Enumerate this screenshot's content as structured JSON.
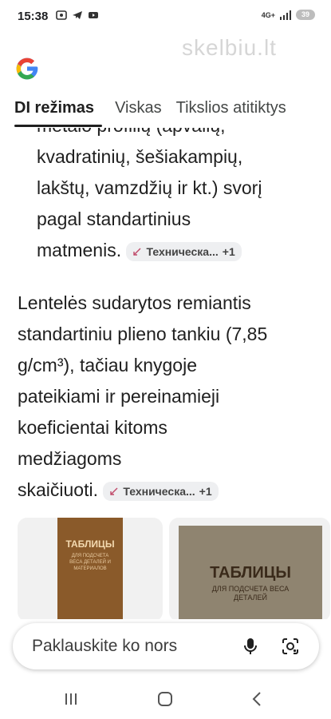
{
  "status": {
    "time": "15:38",
    "network": "4G+",
    "battery": "39"
  },
  "watermark": "skelbiu.lt",
  "tabs": [
    {
      "label": "DI režimas"
    },
    {
      "label": "Viskas"
    },
    {
      "label": "Tikslios atitiktys"
    }
  ],
  "content": {
    "para1_lines": [
      "metalo profilių (apvalių,",
      "kvadratinių, šešiakampių,",
      "lakštų, vamzdžių ir kt.) svorį",
      "pagal standartinius",
      "matmenis."
    ],
    "para2_lines": [
      "Lentelės sudarytos remiantis",
      "standartiniu plieno tankiu (7,85",
      "g/cm³), tačiau knygoje",
      "pateikiami ir pereinamieji",
      "koeficientai kitoms",
      "medžiagoms",
      "skaičiuoti."
    ],
    "chip1": {
      "label": "Техническа...",
      "count": "+1"
    },
    "chip2": {
      "label": "Техническа...",
      "count": "+1"
    }
  },
  "cards": [
    {
      "title": "ТАБЛИЦЫ",
      "subtitle": "ДЛЯ ПОДСЧЕТА ВЕСА ДЕТАЛЕЙ И МАТЕРИАЛОВ"
    },
    {
      "title": "ТАБЛИЦЫ",
      "subtitle": "ДЛЯ ПОДСЧЕТА ВЕСА ДЕТАЛЕЙ"
    }
  ],
  "search": {
    "placeholder": "Paklauskite ko nors"
  },
  "colors": {
    "google_blue": "#4285F4",
    "google_red": "#EA4335",
    "google_yellow": "#FBBC05",
    "google_green": "#34A853"
  },
  "icons": [
    "google-logo-icon",
    "mic-icon",
    "lens-icon",
    "back-icon",
    "home-icon",
    "recents-icon"
  ]
}
